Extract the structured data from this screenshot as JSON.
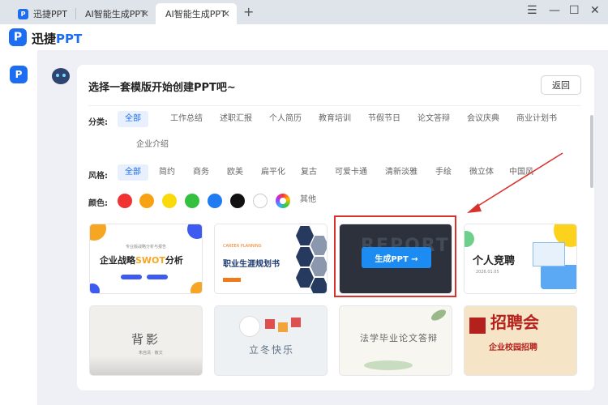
{
  "tabs": [
    {
      "label": "迅捷PPT"
    },
    {
      "label": "AI智能生成PPT"
    },
    {
      "label": "AI智能生成PPT"
    }
  ],
  "tab_close": "✕",
  "new_tab": "+",
  "window": {
    "menu": "☰",
    "minimize": "—",
    "maximize": "☐",
    "close": "✕"
  },
  "brand": {
    "name_prefix": "迅捷",
    "name_suffix": "PPT",
    "logo_letter": "P"
  },
  "panel": {
    "title": "选择一套模版开始创建PPT吧~",
    "back_label": "返回"
  },
  "filters": {
    "category_label": "分类:",
    "categories": [
      "全部",
      "工作总结",
      "述职汇报",
      "个人简历",
      "教育培训",
      "节假节日",
      "论文答辩",
      "会议庆典",
      "商业计划书",
      "企业介绍"
    ],
    "style_label": "风格:",
    "styles": [
      "全部",
      "简约",
      "商务",
      "欧美",
      "扁平化",
      "复古",
      "可爱卡通",
      "清新淡雅",
      "手绘",
      "微立体",
      "中国风"
    ],
    "color_label": "颜色:",
    "colors": [
      "#f03232",
      "#f7a213",
      "#fada0b",
      "#35c13f",
      "#1f7bf2",
      "#111111",
      "#ffffff"
    ],
    "color_other": "其他"
  },
  "templates": [
    {
      "title_a": "企业战略",
      "title_b": "SWOT",
      "title_c": "分析",
      "sub": "专业版战略分析与报告"
    },
    {
      "title": "职业生涯规划书",
      "sub": "CAREER PLANNING"
    },
    {
      "title": "REPORT",
      "button": "生成PPT →"
    },
    {
      "title": "个人竞聘",
      "sub": "2026.01.05"
    },
    {
      "title": "背影",
      "sub": "朱自清 · 散文"
    },
    {
      "title": "立冬快乐"
    },
    {
      "title": "法学毕业论文答辩"
    },
    {
      "title": "招聘会",
      "sub": "企业校园招聘"
    }
  ]
}
